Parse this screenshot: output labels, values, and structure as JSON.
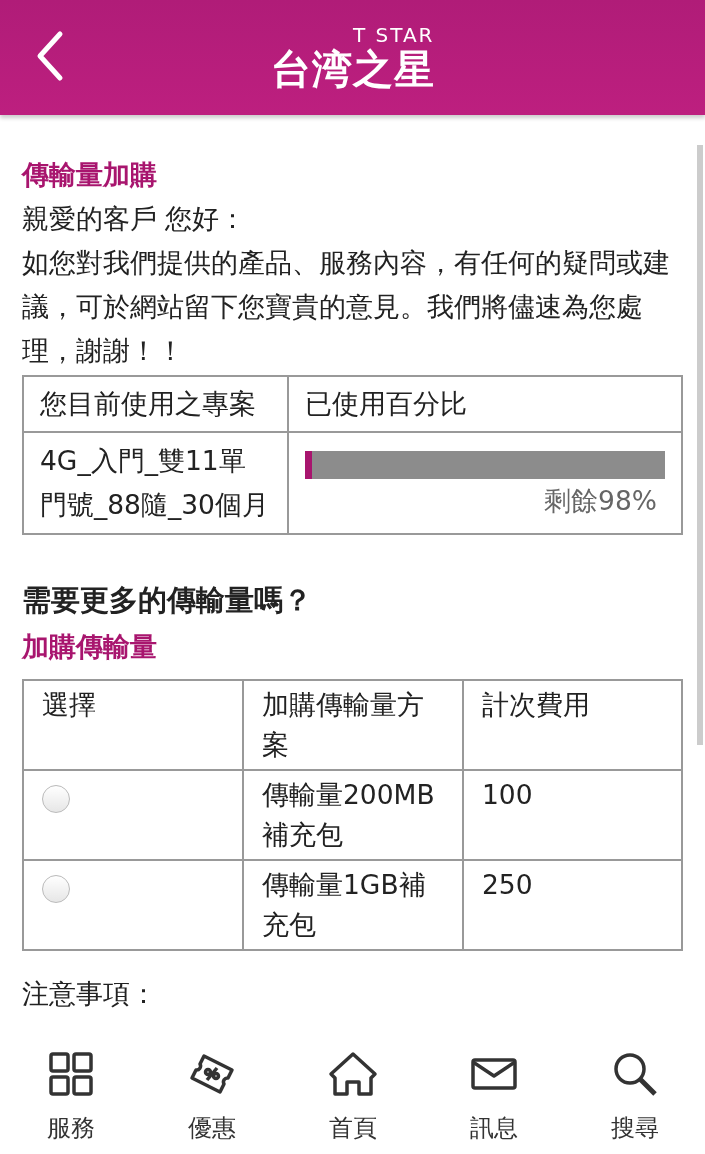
{
  "header": {
    "brand_top": "T STAR",
    "brand": "台湾之星"
  },
  "section_title": "傳輸量加購",
  "greeting": "親愛的客戶 您好：",
  "intro": "如您對我們提供的產品、服務內容，有任何的疑問或建議，可於網站留下您寶貴的意見。我們將儘速為您處理，謝謝！！",
  "usage_table": {
    "columns": [
      "您目前使用之專案",
      "已使用百分比"
    ],
    "plan": "4G_入門_雙11單門號_88隨_30個月",
    "level": 0.02,
    "reading": "剩餘98%"
  },
  "question": "需要更多的傳輸量嗎？",
  "addon_title": "加購傳輸量",
  "addon_table": {
    "columns": [
      "選擇",
      "加購傳輸量方案",
      "計次費用"
    ],
    "rows": [
      {
        "selected": false,
        "plan": "傳輸量200MB補充包",
        "fee": "100"
      },
      {
        "selected": false,
        "plan": "傳輸量1GB補充包",
        "fee": "250"
      }
    ]
  },
  "notes_title": "注意事項：",
  "nav": [
    {
      "kind": "grid",
      "label": "服務"
    },
    {
      "kind": "coupon",
      "label": "優惠"
    },
    {
      "kind": "home",
      "label": "首頁"
    },
    {
      "kind": "mail",
      "label": "訊息"
    },
    {
      "kind": "search",
      "label": "搜尋"
    }
  ]
}
